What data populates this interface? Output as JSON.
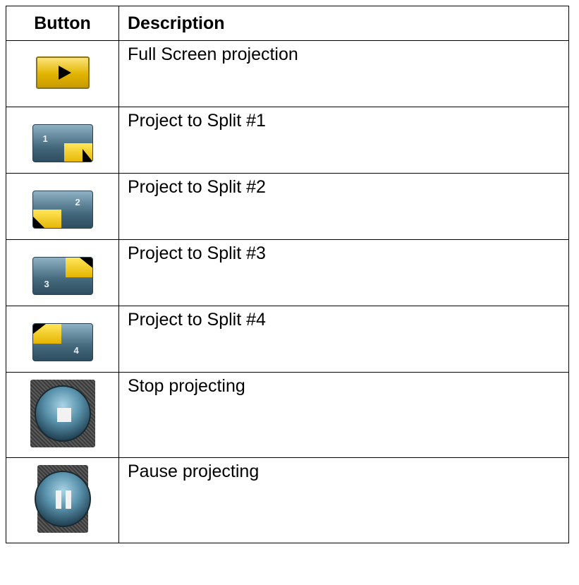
{
  "table": {
    "header_button": "Button",
    "header_description": "Description"
  },
  "rows": [
    {
      "icon": "play-icon",
      "description": "Full Screen projection"
    },
    {
      "icon": "split-1-icon",
      "description": "Project to Split #1"
    },
    {
      "icon": "split-2-icon",
      "description": "Project to Split #2"
    },
    {
      "icon": "split-3-icon",
      "description": "Project to Split #3"
    },
    {
      "icon": "split-4-icon",
      "description": "Project to Split #4"
    },
    {
      "icon": "stop-icon",
      "description": "Stop projecting"
    },
    {
      "icon": "pause-icon",
      "description": "Pause projecting"
    }
  ],
  "icon_labels": {
    "split1": "1",
    "split2": "2",
    "split3": "3",
    "split4": "4"
  },
  "colors": {
    "accent_yellow": "#e2b400",
    "button_blue": "#44687c"
  }
}
